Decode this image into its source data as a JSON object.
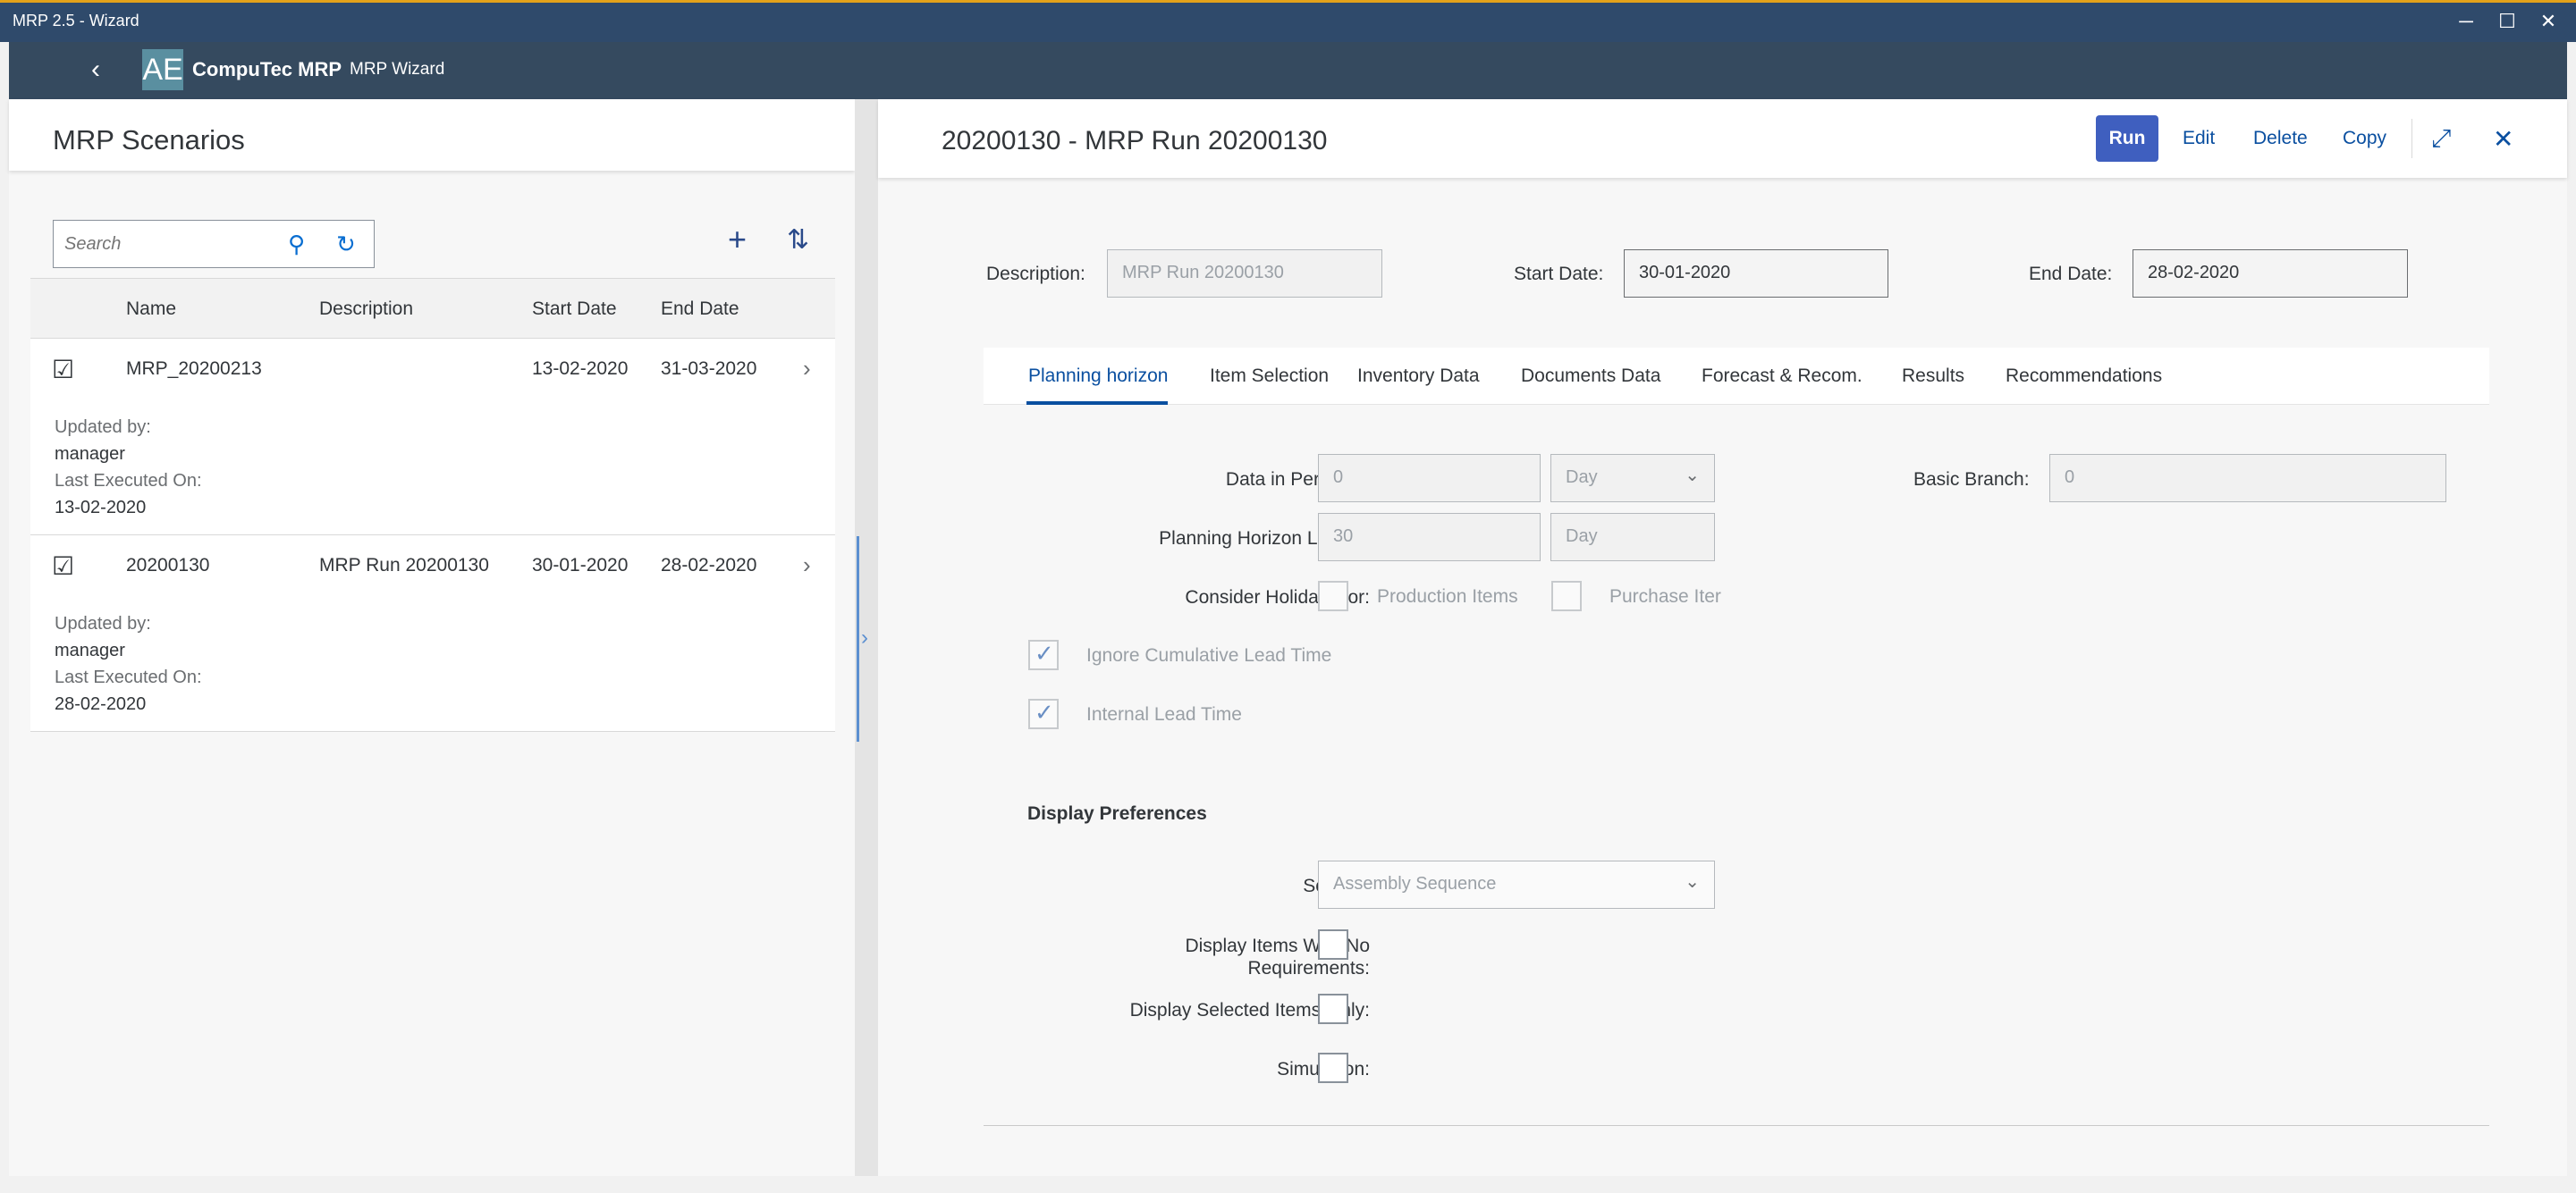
{
  "window": {
    "title": "MRP 2.5 - Wizard"
  },
  "shell": {
    "logo_text": "AE",
    "brand": "CompuTec MRP",
    "subtitle": "MRP Wizard"
  },
  "left": {
    "title": "MRP Scenarios",
    "search_placeholder": "Search",
    "columns": [
      "Name",
      "Description",
      "Start Date",
      "End Date"
    ],
    "rows": [
      {
        "name": "MRP_20200213",
        "description": "",
        "start": "13-02-2020",
        "end": "31-03-2020",
        "updated_by_label": "Updated by:",
        "updated_by": "manager",
        "last_exec_label": "Last Executed On:",
        "last_exec": "13-02-2020"
      },
      {
        "name": "20200130",
        "description": "MRP Run 20200130",
        "start": "30-01-2020",
        "end": "28-02-2020",
        "updated_by_label": "Updated by:",
        "updated_by": "manager",
        "last_exec_label": "Last Executed On:",
        "last_exec": "28-02-2020"
      }
    ]
  },
  "right": {
    "title": "20200130 - MRP Run 20200130",
    "actions": {
      "run": "Run",
      "edit": "Edit",
      "delete": "Delete",
      "copy": "Copy"
    },
    "header_fields": {
      "description_label": "Description:",
      "description_value": "MRP Run 20200130",
      "start_label": "Start Date:",
      "start_value": "30-01-2020",
      "end_label": "End Date:",
      "end_value": "28-02-2020"
    },
    "tabs": [
      "Planning horizon",
      "Item Selection",
      "Inventory Data",
      "Documents Data",
      "Forecast & Recom.",
      "Results",
      "Recommendations"
    ],
    "selected_tab": "Planning horizon",
    "planning": {
      "periods_label": "Data in Perios of:",
      "periods_value": "0",
      "periods_unit": "Day",
      "branch_label": "Basic Branch:",
      "branch_value": "0",
      "horizon_label": "Planning Horizon Length:",
      "horizon_value": "30",
      "horizon_unit": "Day",
      "holidays_label": "Consider Holidays for:",
      "production_items": "Production Items",
      "purchase_items": "Purchase Iter",
      "ignore_cumulative": "Ignore Cumulative Lead Time",
      "internal_lead": "Internal Lead Time"
    },
    "display": {
      "title": "Display Preferences",
      "sort_label": "Sort By:",
      "sort_value": "Assembly Sequence",
      "no_req_label_1": "Display Items With No",
      "no_req_label_2": "Requirements:",
      "selected_only_label": "Display Selected Items Only:",
      "simulation_label": "Simulation:"
    }
  }
}
